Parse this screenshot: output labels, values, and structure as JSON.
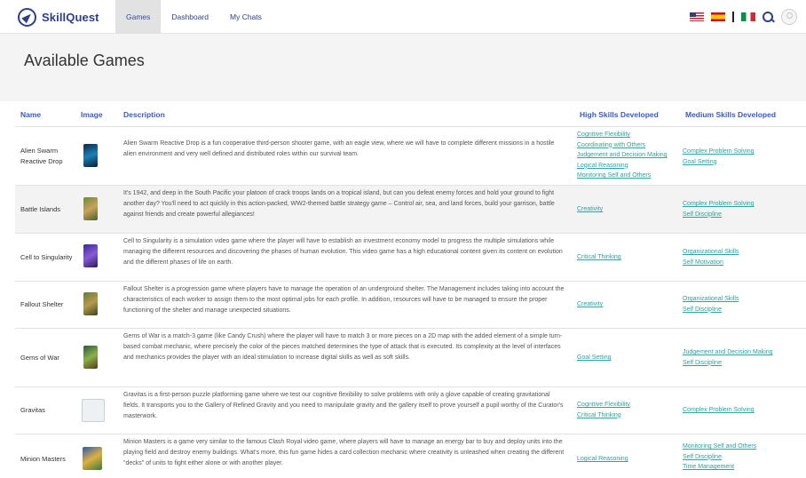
{
  "header": {
    "brand": "SkillQuest",
    "nav": [
      "Games",
      "Dashboard",
      "My Chats"
    ]
  },
  "page": {
    "title": "Available Games"
  },
  "table": {
    "columns": [
      "Name",
      "Image",
      "Description",
      "High Skills Developed",
      "Medium Skills Developed"
    ],
    "rows": [
      {
        "name": "Alien Swarm Reactive Drop",
        "description": "Alien Swarm Reactive Drop is a fun cooperative third-person shooter game, with an eagle view, where we will have to complete different missions in a hostile alien environment and very well defined and distributed roles within our survival team.",
        "high": [
          "Cognitive Flexibility",
          "Coordinating with Others",
          "Judgement and Decision Making",
          "Logical Reasoning",
          "Monitoring Self and Others"
        ],
        "medium": [
          "Complex Problem Solving",
          "Goal Setting"
        ]
      },
      {
        "name": "Battle Islands",
        "description": "It's 1942, and deep in the South Pacific your platoon of crack troops lands on a tropical island, but can you defeat enemy forces and hold your ground to fight another day? You'll need to act quickly in this action-packed, WW2-themed battle strategy game – Control air, sea, and land forces, build your garrison, battle against friends and create powerful allegiances!",
        "high": [
          "Creativity"
        ],
        "medium": [
          "Complex Problem Solving",
          "Self Discipline"
        ]
      },
      {
        "name": "Cell to Singularity",
        "description": "Cell to Singularity is a simulation video game where the player will have to establish an investment economy model to progress the multiple simulations while managing the different resources and discovering the phases of human evolution. This video game has a high educational content given its content on evolution and the different phases of life on earth.",
        "high": [
          "Critical Thinking"
        ],
        "medium": [
          "Organizational Skills",
          "Self Motivation"
        ]
      },
      {
        "name": "Fallout Shelter",
        "description": "Fallout Shelter is a progression game where players have to manage the operation of an underground shelter. The Management includes taking into account the characteristics of each worker to assign them to the most optimal jobs for each profile. In addition, resources will have to be managed to ensure the proper functioning of the shelter and manage unexpected situations.",
        "high": [
          "Creativity"
        ],
        "medium": [
          "Organizational Skills",
          "Self Discipline"
        ]
      },
      {
        "name": "Gems of War",
        "description": "Gems of War is a match-3 game (like Candy Crush) where the player will have to match 3 or more pieces on a 2D map with the added element of a simple turn-based combat mechanic, where precisely the color of the pieces matched determines the type of attack that is executed. Its complexity at the level of interfaces and mechanics provides the player with an ideal stimulation to increase digital skills as well as soft skills.",
        "high": [
          "Goal Setting"
        ],
        "medium": [
          "Judgement and Decision Making",
          "Self Discipline"
        ]
      },
      {
        "name": "Gravitas",
        "description": "Gravitas is a first-person puzzle platforming game where we test our cognitive flexibility to solve problems with only a glove capable of creating gravitational fields. It transports you to the Gallery of Refined Gravity and you need to manipulate gravity and the gallery itself to prove yourself a pupil worthy of the Curator's masterwork.",
        "high": [
          "Cognitive Flexibility",
          "Critical Thinking"
        ],
        "medium": [
          "Complex Problem Solving"
        ]
      },
      {
        "name": "Minion Masters",
        "description": "Minion Masters is a game very similar to the famous Clash Royal video game, where players will have to manage an energy bar to buy and deploy units into the playing field and destroy enemy buildings. What's more, this fun game hides a card collection mechanic where creativity is unleashed when creating the different \"decks\" of units to fight either alone or with another player.",
        "high": [
          "Logical Reasoning"
        ],
        "medium": [
          "Monitoring Self and Others",
          "Self Discipline",
          "Time Management"
        ]
      }
    ]
  }
}
